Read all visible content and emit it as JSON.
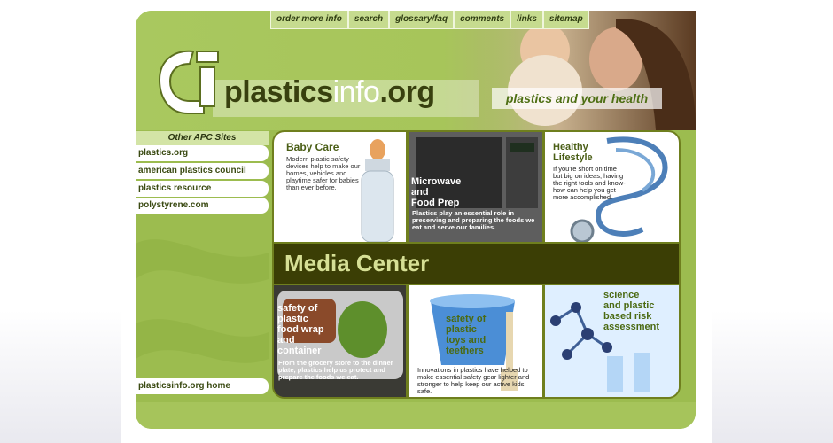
{
  "nav": {
    "items": [
      "order more info",
      "search",
      "glossary/faq",
      "comments",
      "links",
      "sitemap"
    ]
  },
  "logo": {
    "part1": "plastics",
    "part2": "info",
    "part3": ".org"
  },
  "tagline": "plastics and your health",
  "sidebar": {
    "title": "Other APC Sites",
    "links": [
      "plastics.org",
      "american plastics council",
      "plastics resource",
      "polystyrene.com"
    ],
    "home": "plasticsinfo.org home"
  },
  "tiles": {
    "baby": {
      "title": "Baby Care",
      "body": "Modern plastic safety devices help to make our homes, vehicles and playtime safer for babies than ever before."
    },
    "micro": {
      "title1": "Microwave",
      "title2": "and",
      "title3": "Food Prep",
      "body": "Plastics play an essential role in preserving and preparing the foods we eat and serve our families."
    },
    "healthy": {
      "title1": "Healthy",
      "title2": "Lifestyle",
      "body": "If you're short on time but big on ideas, having the right tools and know-how can help you get more accomplished."
    },
    "media": "Media Center",
    "food": {
      "title1": "safety of",
      "title2": "plastic",
      "title3": "food wrap",
      "title4": "and",
      "title5": "container",
      "body": "From the grocery store to the dinner plate, plastics help us protect and prepare the foods we eat."
    },
    "toys": {
      "title1": "safety of",
      "title2": "plastic",
      "title3": "toys and",
      "title4": "teethers",
      "body": "Innovations in plastics have helped to make essential safety gear lighter and stronger to help keep our active kids safe."
    },
    "sci": {
      "title1": "science",
      "title2": "and plastic",
      "title3": "based risk",
      "title4": "assessment"
    }
  },
  "colors": {
    "panel": "#9cbc4f",
    "dark": "#3b3e05",
    "accent": "#d6df95"
  }
}
